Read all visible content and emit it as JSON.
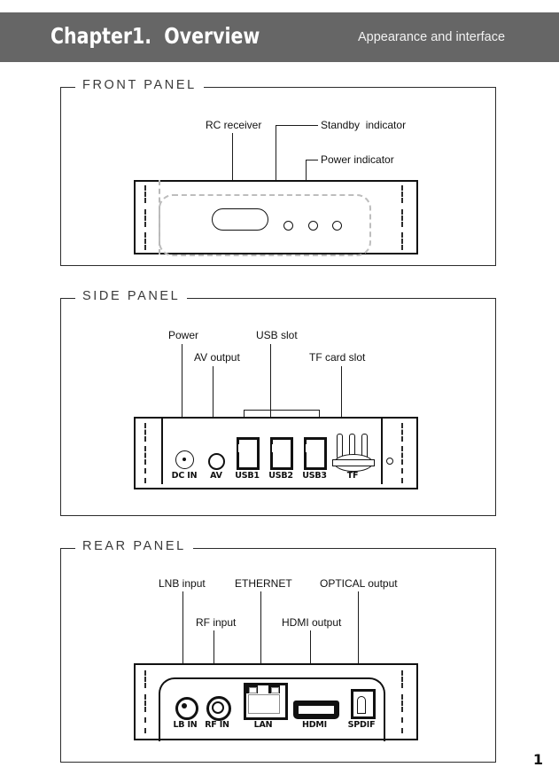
{
  "header": {
    "title": "Chapter1.  Overview",
    "subtitle": "Appearance and interface"
  },
  "front_panel": {
    "legend": "FRONT PANEL",
    "callouts": [
      {
        "label": "RC receiver"
      },
      {
        "label": "Standby  indicator"
      },
      {
        "label": "Power indicator"
      }
    ]
  },
  "side_panel": {
    "legend": "SIDE PANEL",
    "callouts": [
      {
        "label": "Power"
      },
      {
        "label": "AV output"
      },
      {
        "label": "USB slot"
      },
      {
        "label": "TF card slot"
      }
    ],
    "ports": [
      {
        "label": "DC IN"
      },
      {
        "label": "AV"
      },
      {
        "label": "USB1"
      },
      {
        "label": "USB2"
      },
      {
        "label": "USB3"
      },
      {
        "label": "TF"
      }
    ]
  },
  "rear_panel": {
    "legend": "REAR PANEL",
    "callouts": [
      {
        "label": "LNB input"
      },
      {
        "label": "RF input"
      },
      {
        "label": "ETHERNET"
      },
      {
        "label": "HDMI output"
      },
      {
        "label": "OPTICAL output"
      }
    ],
    "ports": [
      {
        "label": "LB IN"
      },
      {
        "label": "RF IN"
      },
      {
        "label": "LAN"
      },
      {
        "label": "HDMI"
      },
      {
        "label": "SPDIF"
      }
    ]
  },
  "footer": {
    "page_number": "1"
  },
  "colors": {
    "header_bg": "#666666",
    "header_text": "#ffffff",
    "line": "#1c1c1c",
    "legend_text": "#3a3a3a"
  }
}
